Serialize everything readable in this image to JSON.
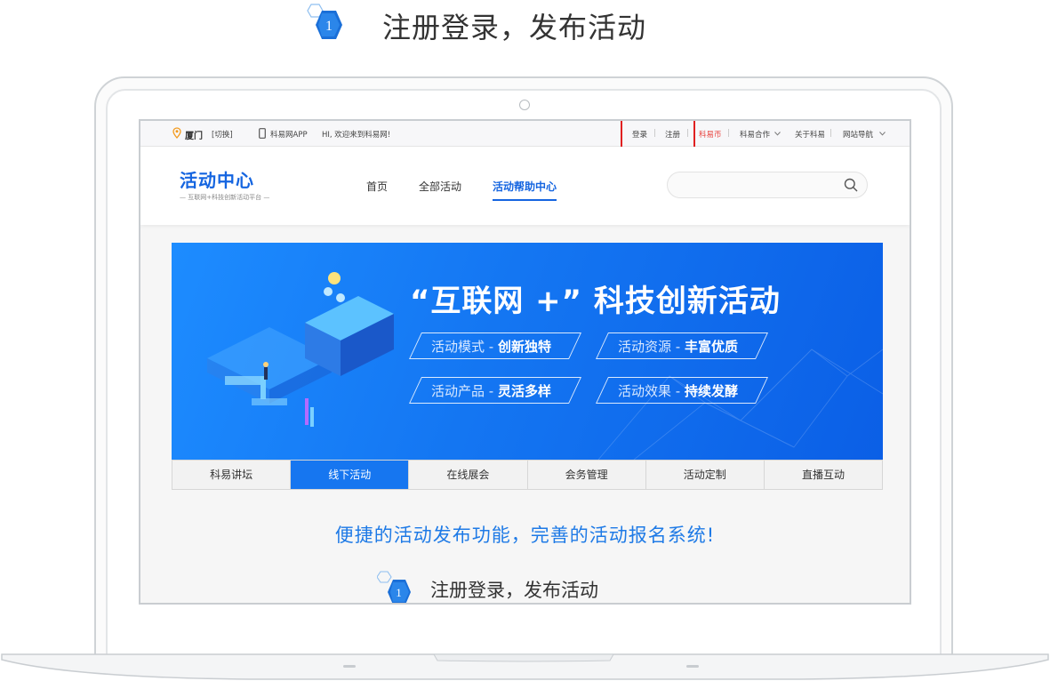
{
  "step": {
    "number": "1",
    "title": "注册登录，发布活动"
  },
  "topbar": {
    "city": "厦门",
    "switch": "[切换]",
    "app": "科易网APP",
    "welcome": "HI, 欢迎来到科易网!",
    "login": "登录",
    "register": "注册",
    "coin": "科易币",
    "coop": "科易合作",
    "about": "关于科易",
    "sitenav": "网站导航"
  },
  "header": {
    "logo": "活动中心",
    "logo_sub": "— 互联网+科技创新活动平台 —",
    "nav": [
      "首页",
      "全部活动",
      "活动帮助中心"
    ],
    "search_placeholder": ""
  },
  "banner": {
    "title": "“互联网 +” 科技创新活动",
    "pills": [
      {
        "label": "活动模式 - ",
        "value": "创新独特"
      },
      {
        "label": "活动资源 - ",
        "value": "丰富优质"
      },
      {
        "label": "活动产品 - ",
        "value": "灵活多样"
      },
      {
        "label": "活动效果 - ",
        "value": "持续发酵"
      }
    ]
  },
  "tabs": [
    "科易讲坛",
    "线下活动",
    "在线展会",
    "会务管理",
    "活动定制",
    "直播互动"
  ],
  "active_tab": "线下活动",
  "slogan": "便捷的活动发布功能，完善的活动报名系统!",
  "inner_step": {
    "number": "1",
    "title": "注册登录，发布活动"
  },
  "colors": {
    "brand": "#1565e0",
    "banner": "#1476f2",
    "highlight": "#e02020",
    "coin": "#e8413c"
  }
}
